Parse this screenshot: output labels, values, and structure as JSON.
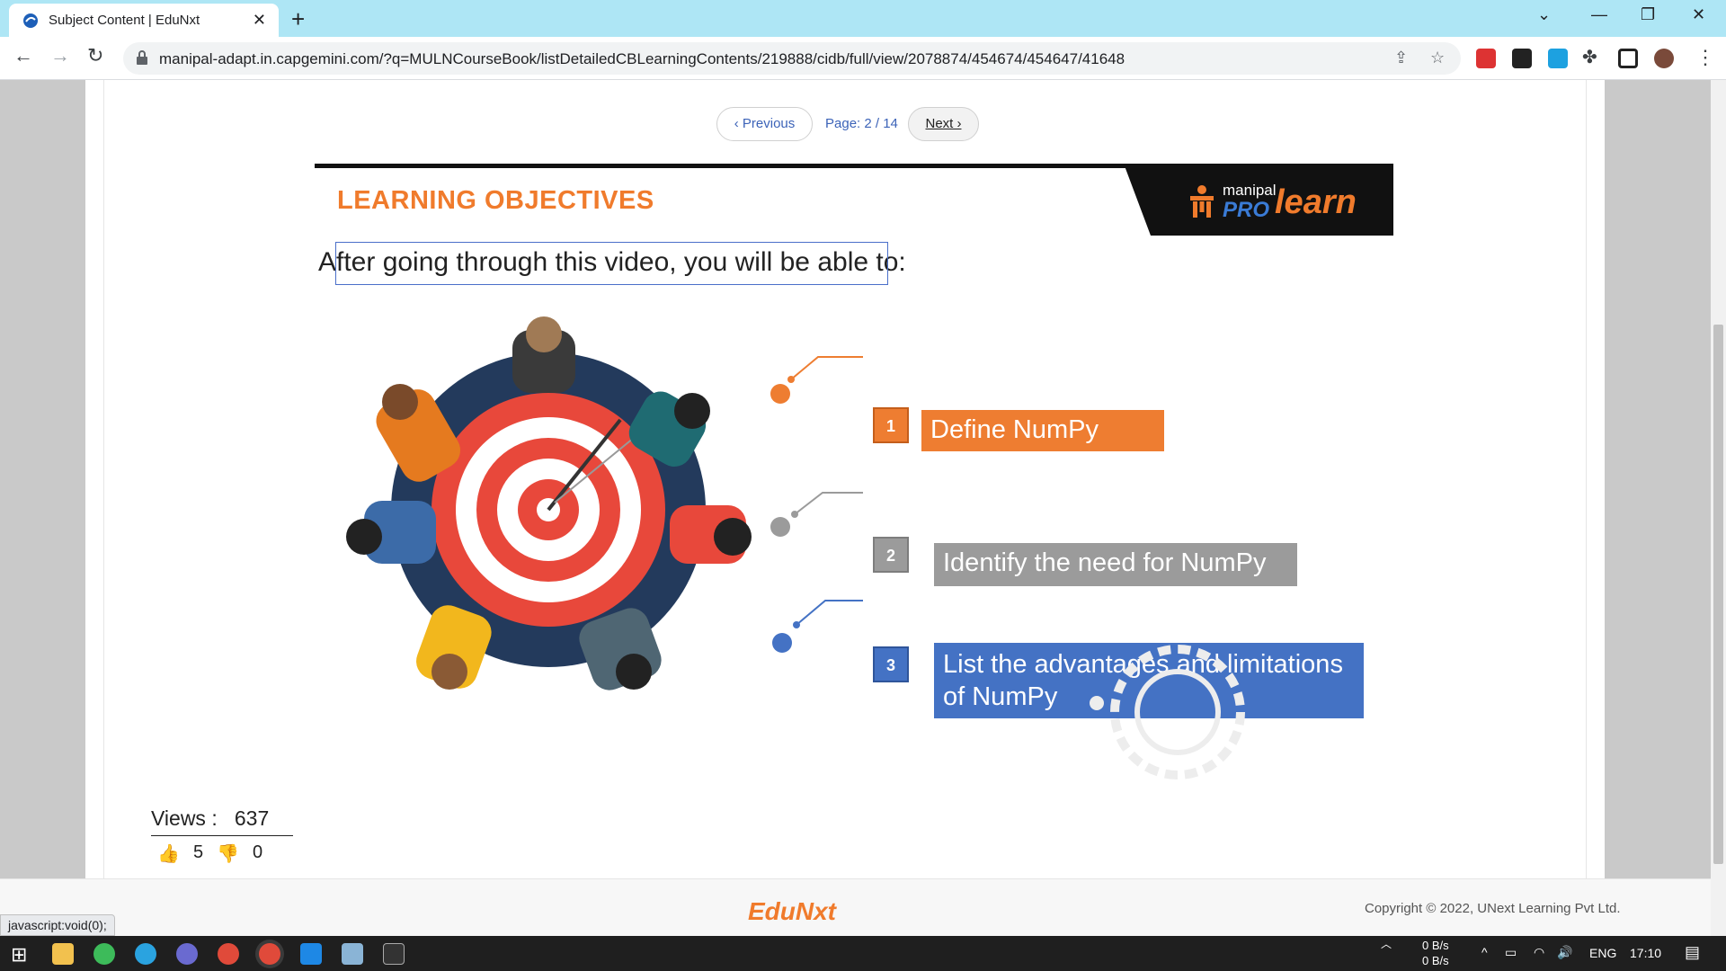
{
  "browser": {
    "tab_title": "Subject Content | EduNxt",
    "url": "manipal-adapt.in.capgemini.com/?q=MULNCourseBook/listDetailedCBLearningContents/219888/cidb/full/view/2078874/454674/454647/41648"
  },
  "pager": {
    "previous": "‹ Previous",
    "page_label": "Page: 2 / 14",
    "next": "Next ›"
  },
  "slide": {
    "heading": "LEARNING OBJECTIVES",
    "logo_top": "manipal",
    "logo_pro": "PRO",
    "logo_learn": "learn",
    "subtitle": "After going through this video, you will be able to:",
    "objectives": [
      {
        "num": "1",
        "text": "Define NumPy",
        "color": "#ee7d31"
      },
      {
        "num": "2",
        "text": "Identify the need for NumPy",
        "color": "#9b9b9b"
      },
      {
        "num": "3",
        "text": "List the advantages and limitations of NumPy",
        "color": "#4472c4"
      }
    ]
  },
  "stats": {
    "views_label": "Views :",
    "views_count": "637",
    "likes": "5",
    "dislikes": "0"
  },
  "footer": {
    "brand": "EduNxt",
    "copyright": "Copyright © 2022, UNext Learning Pvt Ltd.",
    "status": "javascript:void(0);"
  },
  "taskbar": {
    "net_up": "0 B/s",
    "net_down": "0 B/s",
    "lang": "ENG",
    "time": "17:10"
  }
}
